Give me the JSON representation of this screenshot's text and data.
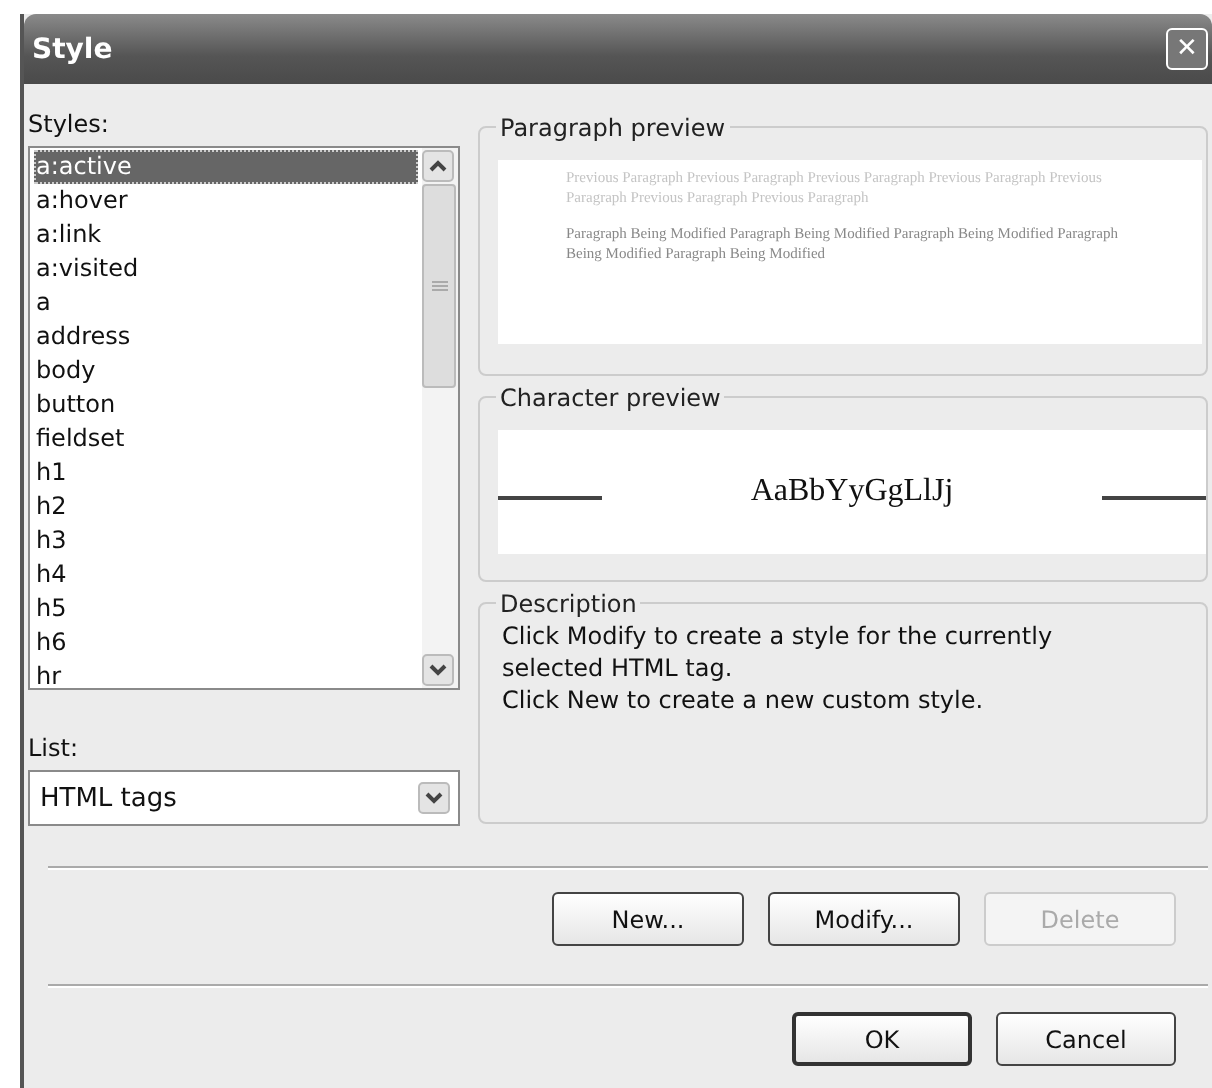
{
  "window": {
    "title": "Style",
    "close": "✕"
  },
  "styles": {
    "label": "Styles:",
    "items": [
      {
        "text": "a:active",
        "selected": true
      },
      {
        "text": "a:hover",
        "selected": false
      },
      {
        "text": "a:link",
        "selected": false
      },
      {
        "text": "a:visited",
        "selected": false
      },
      {
        "text": "a",
        "selected": false
      },
      {
        "text": "address",
        "selected": false
      },
      {
        "text": "body",
        "selected": false
      },
      {
        "text": "button",
        "selected": false
      },
      {
        "text": "fieldset",
        "selected": false
      },
      {
        "text": "h1",
        "selected": false
      },
      {
        "text": "h2",
        "selected": false
      },
      {
        "text": "h3",
        "selected": false
      },
      {
        "text": "h4",
        "selected": false
      },
      {
        "text": "h5",
        "selected": false
      },
      {
        "text": "h6",
        "selected": false
      },
      {
        "text": "hr",
        "selected": false
      }
    ]
  },
  "list": {
    "label": "List:",
    "value": "HTML tags"
  },
  "paragraph_preview": {
    "title": "Paragraph preview",
    "previous": "Previous Paragraph Previous Paragraph Previous Paragraph Previous Paragraph Previous Paragraph Previous Paragraph Previous Paragraph",
    "modified": "Paragraph Being Modified Paragraph Being Modified Paragraph Being Modified Paragraph Being Modified Paragraph Being Modified"
  },
  "character_preview": {
    "title": "Character preview",
    "sample": "AaBbYyGgLlJj"
  },
  "description": {
    "title": "Description",
    "lines": [
      "Click Modify to create a style for the currently selected HTML tag.",
      "Click New to create a new custom style."
    ]
  },
  "actions": [
    {
      "label": "New...",
      "disabled": false
    },
    {
      "label": "Modify...",
      "disabled": false
    },
    {
      "label": "Delete",
      "disabled": true
    }
  ],
  "dialog_buttons": [
    {
      "label": "OK",
      "default": true
    },
    {
      "label": "Cancel",
      "default": false
    }
  ]
}
